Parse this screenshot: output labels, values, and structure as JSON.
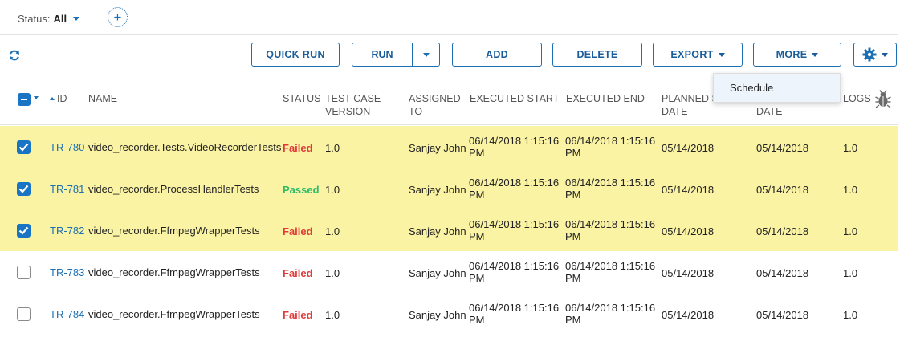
{
  "filter": {
    "status_label": "Status:",
    "status_value": "All",
    "add_symbol": "+"
  },
  "toolbar": {
    "quick_run": "QUICK RUN",
    "run": "RUN",
    "add": "ADD",
    "delete": "DELETE",
    "export": "EXPORT",
    "more": "MORE"
  },
  "more_menu": {
    "items": [
      "Schedule"
    ]
  },
  "columns": {
    "id": "ID",
    "name": "NAME",
    "status": "STATUS",
    "version_1": "TEST CASE",
    "version_2": "VERSION",
    "assigned_1": "ASSIGNED",
    "assigned_2": "TO",
    "exec_start": "EXECUTED START",
    "exec_end": "EXECUTED END",
    "planned_start_1": "PLANNED S",
    "planned_start_2": "DATE",
    "planned_end_2": "DATE",
    "logs": "LOGS"
  },
  "rows": [
    {
      "selected": true,
      "id": "TR-780",
      "name": "video_recorder.Tests.VideoRecorderTests",
      "status": "Failed",
      "version": "1.0",
      "assigned": "Sanjay John",
      "exec_start_1": "06/14/2018 1:15:16",
      "exec_start_2": "PM",
      "exec_end_1": "06/14/2018 1:15:16",
      "exec_end_2": "PM",
      "planned_start": "05/14/2018",
      "planned_end": "05/14/2018",
      "logs": "1.0"
    },
    {
      "selected": true,
      "id": "TR-781",
      "name": "video_recorder.ProcessHandlerTests",
      "status": "Passed",
      "version": "1.0",
      "assigned": "Sanjay John",
      "exec_start_1": "06/14/2018 1:15:16",
      "exec_start_2": "PM",
      "exec_end_1": "06/14/2018 1:15:16",
      "exec_end_2": "PM",
      "planned_start": "05/14/2018",
      "planned_end": "05/14/2018",
      "logs": "1.0"
    },
    {
      "selected": true,
      "id": "TR-782",
      "name": "video_recorder.FfmpegWrapperTests",
      "status": "Failed",
      "version": "1.0",
      "assigned": "Sanjay John",
      "exec_start_1": "06/14/2018 1:15:16",
      "exec_start_2": "PM",
      "exec_end_1": "06/14/2018 1:15:16",
      "exec_end_2": "PM",
      "planned_start": "05/14/2018",
      "planned_end": "05/14/2018",
      "logs": "1.0"
    },
    {
      "selected": false,
      "id": "TR-783",
      "name": "video_recorder.FfmpegWrapperTests",
      "status": "Failed",
      "version": "1.0",
      "assigned": "Sanjay John",
      "exec_start_1": "06/14/2018 1:15:16",
      "exec_start_2": "PM",
      "exec_end_1": "06/14/2018 1:15:16",
      "exec_end_2": "PM",
      "planned_start": "05/14/2018",
      "planned_end": "05/14/2018",
      "logs": "1.0"
    },
    {
      "selected": false,
      "id": "TR-784",
      "name": "video_recorder.FfmpegWrapperTests",
      "status": "Failed",
      "version": "1.0",
      "assigned": "Sanjay John",
      "exec_start_1": "06/14/2018 1:15:16",
      "exec_start_2": "PM",
      "exec_end_1": "06/14/2018 1:15:16",
      "exec_end_2": "PM",
      "planned_start": "05/14/2018",
      "planned_end": "05/14/2018",
      "logs": "1.0"
    }
  ],
  "icons": {
    "refresh": "refresh-icon",
    "settings": "gear-icon",
    "logs": "bug-icon",
    "checkbox": "checkbox-icon"
  },
  "colors": {
    "accent": "#1a6fb5",
    "selected_row": "#fbf3a4",
    "failed": "#e03b3b",
    "passed": "#2ebc6b"
  }
}
